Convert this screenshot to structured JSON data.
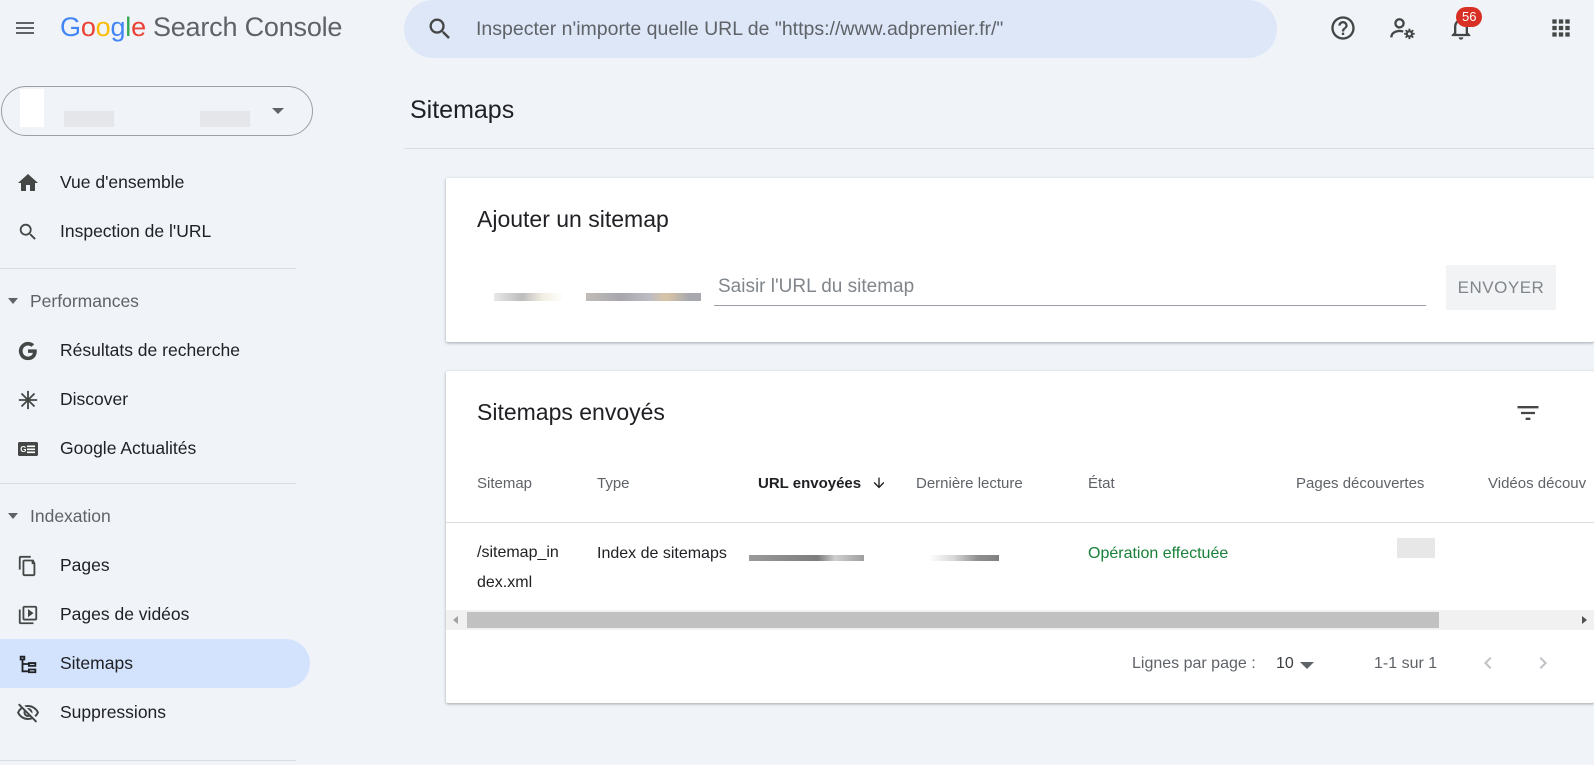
{
  "app": {
    "logo_letters": [
      "G",
      "o",
      "o",
      "g",
      "l",
      "e"
    ],
    "product_name": "Search Console",
    "search_placeholder": "Inspecter n'importe quelle URL de \"https://www.adpremier.fr/\"",
    "notification_count": "56",
    "icons": [
      "menu-icon",
      "search-icon",
      "help-icon",
      "admin-settings-icon",
      "notifications-icon",
      "apps-grid-icon"
    ]
  },
  "sidebar": {
    "items_top": [
      {
        "label": "Vue d'ensemble",
        "icon": "home-icon"
      },
      {
        "label": "Inspection de l'URL",
        "icon": "search-icon"
      }
    ],
    "performance_section": "Performances",
    "performance_items": [
      {
        "label": "Résultats de recherche",
        "icon": "google-g-icon"
      },
      {
        "label": "Discover",
        "icon": "asterisk-icon"
      },
      {
        "label": "Google Actualités",
        "icon": "news-icon"
      }
    ],
    "indexing_section": "Indexation",
    "indexing_items": [
      {
        "label": "Pages",
        "icon": "pages-icon"
      },
      {
        "label": "Pages de vidéos",
        "icon": "video-pages-icon"
      },
      {
        "label": "Sitemaps",
        "icon": "sitemap-icon",
        "active": true
      },
      {
        "label": "Suppressions",
        "icon": "visibility-off-icon"
      }
    ]
  },
  "main": {
    "title": "Sitemaps",
    "add_card": {
      "title": "Ajouter un sitemap",
      "input_placeholder": "Saisir l'URL du sitemap",
      "submit_label": "ENVOYER"
    },
    "sent_card": {
      "title": "Sitemaps envoyés",
      "columns": [
        "Sitemap",
        "Type",
        "URL envoyées",
        "Dernière lecture",
        "État",
        "Pages découvertes",
        "Vidéos découv"
      ],
      "sorted_column_index": 2,
      "rows": [
        {
          "sitemap_line1": "/sitemap_in",
          "sitemap_line2": "dex.xml",
          "type": "Index de sitemaps",
          "status": "Opération effectuée"
        }
      ],
      "footer": {
        "rows_per_page_label": "Lignes par page :",
        "rows_per_page_value": "10",
        "range": "1-1 sur 1"
      }
    }
  },
  "colors": {
    "accent_active": "#d3e3fd",
    "success": "#188038",
    "badge": "#d93025",
    "search_bg": "#dde7f8"
  }
}
